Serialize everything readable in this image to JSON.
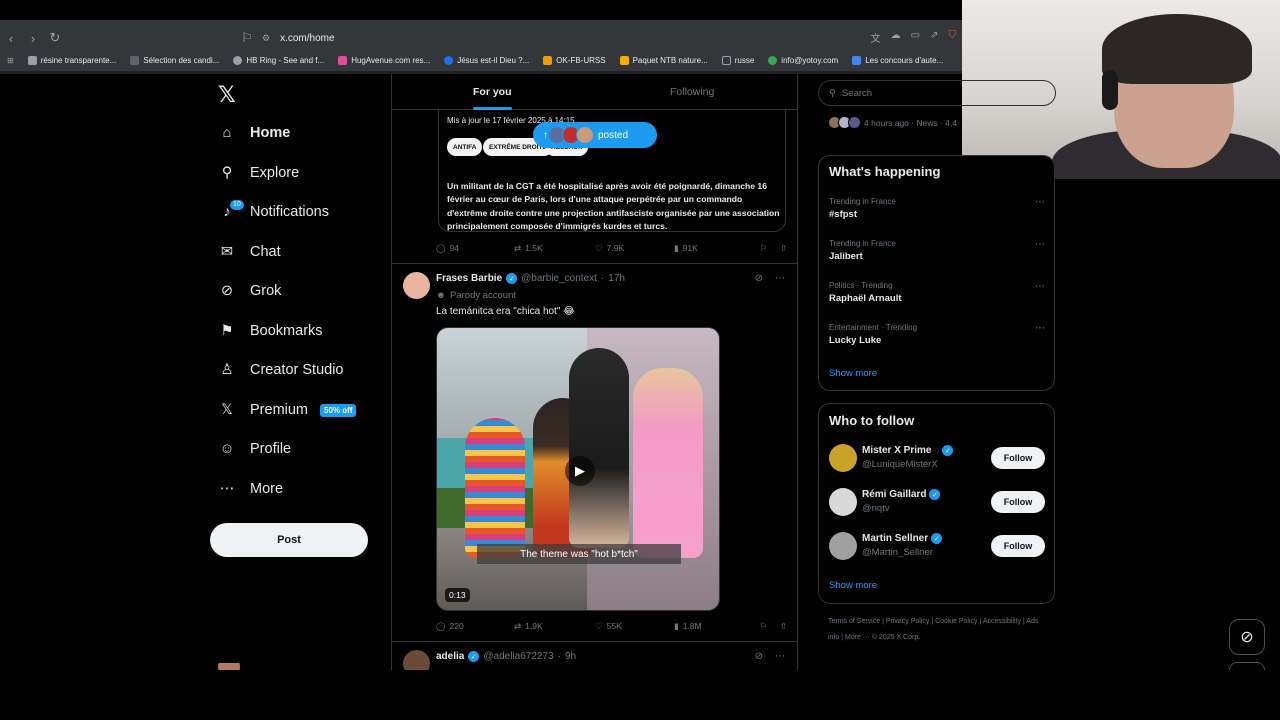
{
  "browser": {
    "url": "x.com/home",
    "bookmarks": [
      {
        "label": "résine transparente...",
        "color": "#9aa0a6"
      },
      {
        "label": "Sélection des candi...",
        "color": "#5f6368"
      },
      {
        "label": "HB Ring - See and f...",
        "color": "#9aa0a6"
      },
      {
        "label": "HugAvenue.com res...",
        "color": "#e24d9a"
      },
      {
        "label": "Jésus est-il Dieu ?...",
        "color": "#1a73e8"
      },
      {
        "label": "OK-FB-URSS",
        "color": "#f29900"
      },
      {
        "label": "Paquet NTB nature...",
        "color": "#f9ab00"
      },
      {
        "label": "russe",
        "color": "#9aa0a6"
      },
      {
        "label": "info@yotoy.com",
        "color": "#34a853"
      },
      {
        "label": "Les concours d'aute...",
        "color": "#4285f4"
      }
    ]
  },
  "sidebar": {
    "logo": "𝕏",
    "items": [
      {
        "label": "Home",
        "icon": "home-icon",
        "glyph": "⌂",
        "active": true
      },
      {
        "label": "Explore",
        "icon": "search-icon",
        "glyph": "⚲"
      },
      {
        "label": "Notifications",
        "icon": "bell-icon",
        "glyph": "♪",
        "badge": "10"
      },
      {
        "label": "Chat",
        "icon": "mail-icon",
        "glyph": "✉"
      },
      {
        "label": "Grok",
        "icon": "grok-icon",
        "glyph": "⊘"
      },
      {
        "label": "Bookmarks",
        "icon": "bookmark-icon",
        "glyph": "⚑"
      },
      {
        "label": "Creator Studio",
        "icon": "creator-studio-icon",
        "glyph": "♙"
      },
      {
        "label": "Premium",
        "icon": "x-premium-icon",
        "glyph": "𝕏",
        "promo": "50% off"
      },
      {
        "label": "Profile",
        "icon": "profile-icon",
        "glyph": "☺"
      },
      {
        "label": "More",
        "icon": "more-icon",
        "glyph": "⋯"
      }
    ],
    "post_label": "Post"
  },
  "feed": {
    "tabs": [
      "For you",
      "Following"
    ],
    "posted_pill": "posted",
    "tweet1": {
      "updated": "Mis à jour le 17 février 2025 à 14:15",
      "tags": [
        "ANTIFA",
        "EXTRÊME DROITE",
        "RÉSEAUX"
      ],
      "body": "Un militant de la CGT a été hospitalisé après avoir été poignardé, dimanche 16 février au cœur de Paris, lors d'une attaque perpétrée par un commando d'extrême droite contre une projection antifasciste organisée par une association principalement composée d'immigrés kurdes et turcs.",
      "replies": "94",
      "reposts": "1.5K",
      "likes": "7.9K",
      "views": "91K"
    },
    "tweet2": {
      "name": "Frases Barbie",
      "handle": "@barbie_context",
      "time": "17h",
      "parody": "Parody account",
      "text": "La temánitca era \"chica hot\" 😂",
      "caption": "The theme was \"hot b*tch\"",
      "duration": "0:13",
      "replies": "220",
      "reposts": "1.9K",
      "likes": "55K",
      "views": "1.8M"
    },
    "tweet3": {
      "name": "adelia",
      "handle": "@adelia672273",
      "time": "9h"
    }
  },
  "right": {
    "search_placeholder": "Search",
    "news_meta": "4 hours ago · News · 4,4",
    "whats_happening": "What's happening",
    "trends": [
      {
        "context": "Trending in France",
        "title": "#sfpst"
      },
      {
        "context": "Trending in France",
        "title": "Jalibert"
      },
      {
        "context": "Politics · Trending",
        "title": "Raphaël Arnault"
      },
      {
        "context": "Entertainment · Trending",
        "title": "Lucky Luke"
      }
    ],
    "show_more": "Show more",
    "who_to_follow": "Who to follow",
    "follows": [
      {
        "name": "Mister X Prime",
        "handle": "@LuniqueMisterX",
        "color": "#c9a227"
      },
      {
        "name": "Rémi Gaillard",
        "handle": "@nqtv",
        "color": "#d9d9d9"
      },
      {
        "name": "Martin Sellner",
        "handle": "@Martin_Sellner",
        "color": "#a0a0a0"
      }
    ],
    "follow_label": "Follow",
    "legal": "Terms of Service  |  Privacy Policy  |  Cookie Policy  |  Accessibility  |  Ads info  |  More ···  © 2025 X Corp."
  }
}
